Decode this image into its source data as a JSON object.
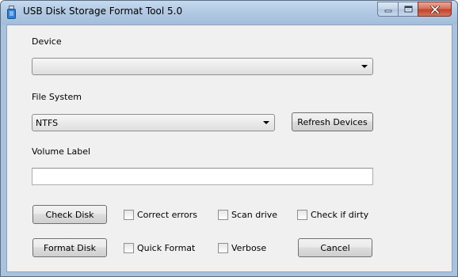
{
  "window": {
    "title": "USB Disk Storage Format Tool 5.0",
    "icon": "usb-drive-icon"
  },
  "device": {
    "label": "Device",
    "selected": ""
  },
  "file_system": {
    "label": "File System",
    "selected": "NTFS"
  },
  "volume_label": {
    "label": "Volume Label",
    "value": ""
  },
  "buttons": {
    "refresh_devices": "Refresh Devices",
    "check_disk": "Check Disk",
    "format_disk": "Format Disk",
    "cancel": "Cancel"
  },
  "checkboxes": {
    "correct_errors": {
      "label": "Correct errors",
      "checked": false
    },
    "scan_drive": {
      "label": "Scan drive",
      "checked": false
    },
    "check_if_dirty": {
      "label": "Check if dirty",
      "checked": false
    },
    "quick_format": {
      "label": "Quick Format",
      "checked": false
    },
    "verbose": {
      "label": "Verbose",
      "checked": false
    }
  }
}
